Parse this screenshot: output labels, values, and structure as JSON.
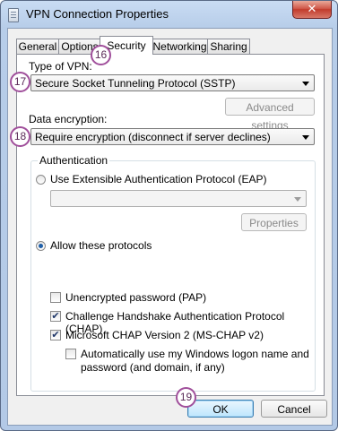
{
  "window": {
    "title": "VPN Connection Properties",
    "close_glyph": "✕",
    "accent_color": "#a04f9b"
  },
  "tabs": [
    {
      "label": "General"
    },
    {
      "label": "Options"
    },
    {
      "label": "Security",
      "active": true
    },
    {
      "label": "Networking"
    },
    {
      "label": "Sharing"
    }
  ],
  "security": {
    "vpn_type_label": "Type of VPN:",
    "vpn_type_value": "Secure Socket Tunneling Protocol (SSTP)",
    "advanced_settings_label": "Advanced settings",
    "encryption_label": "Data encryption:",
    "encryption_value": "Require encryption (disconnect if server declines)",
    "auth_group_title": "Authentication",
    "eap_radio_label": "Use Extensible Authentication Protocol (EAP)",
    "eap_select_value": "",
    "properties_label": "Properties",
    "allow_protocols_label": "Allow these protocols",
    "pap_label": "Unencrypted password (PAP)",
    "pap_checked": false,
    "chap_label": "Challenge Handshake Authentication Protocol (CHAP)",
    "chap_checked": true,
    "mschap_label": "Microsoft CHAP Version 2 (MS-CHAP v2)",
    "mschap_checked": true,
    "autologon_label_line1": "Automatically use my Windows logon name and",
    "autologon_label_line2": "password (and domain, if any)",
    "autologon_checked": false
  },
  "footer": {
    "ok_label": "OK",
    "cancel_label": "Cancel"
  },
  "badges": {
    "tab_security": "16",
    "vpn_type": "17",
    "encryption": "18",
    "ok": "19"
  }
}
